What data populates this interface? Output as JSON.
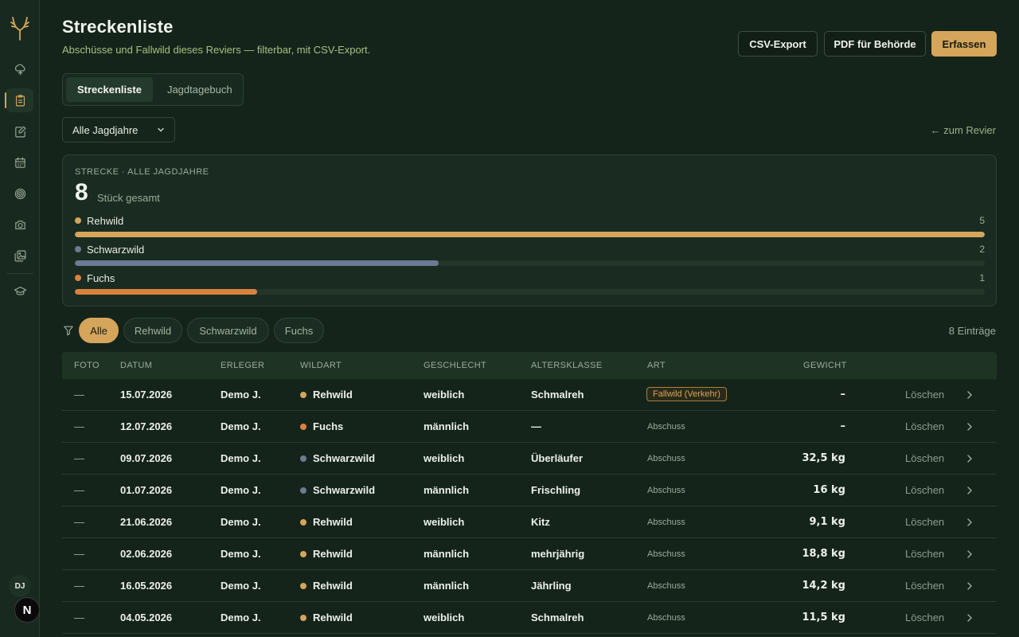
{
  "sidebar": {
    "icons": [
      "antlers-logo-icon",
      "tree-icon",
      "clipboard-icon",
      "notebook-pen-icon",
      "calendar-icon",
      "target-icon",
      "camera-icon",
      "image-gallery-icon",
      "graduation-cap-icon"
    ],
    "active_index": 2,
    "user_initials": "DJ",
    "badge": "N"
  },
  "header": {
    "title": "Streckenliste",
    "subtitle": "Abschüsse und Fallwild dieses Reviers — filterbar, mit CSV-Export.",
    "csv_label": "CSV-Export",
    "pdf_label": "PDF für Behörde",
    "add_label": "Erfassen"
  },
  "tabs": [
    {
      "label": "Streckenliste",
      "active": true
    },
    {
      "label": "Jagdtagebuch",
      "active": false
    }
  ],
  "season_select": "Alle Jagdjahre",
  "back_link": "← zum Revier",
  "summary": {
    "label": "STRECKE · ALLE JAGDJAHRE",
    "total": "8",
    "total_label": "Stück gesamt",
    "species": [
      {
        "name": "Rehwild",
        "count": 5,
        "color": "#d4a55a"
      },
      {
        "name": "Schwarzwild",
        "count": 2,
        "color": "#6c7a93"
      },
      {
        "name": "Fuchs",
        "count": 1,
        "color": "#d9823f"
      }
    ]
  },
  "filters": {
    "chips": [
      "Alle",
      "Rehwild",
      "Schwarzwild",
      "Fuchs"
    ],
    "active": "Alle",
    "count_label": "8 Einträge"
  },
  "table": {
    "headers": [
      "FOTO",
      "DATUM",
      "ERLEGER",
      "WILDART",
      "GESCHLECHT",
      "ALTERSKLASSE",
      "ART",
      "GEWICHT"
    ],
    "delete_label": "Löschen",
    "rows": [
      {
        "foto": "—",
        "datum": "15.07.2026",
        "erleger": "Demo J.",
        "wildart": "Rehwild",
        "color": "#d4a55a",
        "geschlecht": "weiblich",
        "altersklasse": "Schmalreh",
        "art": "Fallwild (Verkehr)",
        "art_highlight": true,
        "gewicht": "–"
      },
      {
        "foto": "—",
        "datum": "12.07.2026",
        "erleger": "Demo J.",
        "wildart": "Fuchs",
        "color": "#d9823f",
        "geschlecht": "männlich",
        "altersklasse": "—",
        "art": "Abschuss",
        "art_highlight": false,
        "gewicht": "–"
      },
      {
        "foto": "—",
        "datum": "09.07.2026",
        "erleger": "Demo J.",
        "wildart": "Schwarzwild",
        "color": "#6c7a93",
        "geschlecht": "weiblich",
        "altersklasse": "Überläufer",
        "art": "Abschuss",
        "art_highlight": false,
        "gewicht": "32,5 kg"
      },
      {
        "foto": "—",
        "datum": "01.07.2026",
        "erleger": "Demo J.",
        "wildart": "Schwarzwild",
        "color": "#6c7a93",
        "geschlecht": "männlich",
        "altersklasse": "Frischling",
        "art": "Abschuss",
        "art_highlight": false,
        "gewicht": "16 kg"
      },
      {
        "foto": "—",
        "datum": "21.06.2026",
        "erleger": "Demo J.",
        "wildart": "Rehwild",
        "color": "#d4a55a",
        "geschlecht": "weiblich",
        "altersklasse": "Kitz",
        "art": "Abschuss",
        "art_highlight": false,
        "gewicht": "9,1 kg"
      },
      {
        "foto": "—",
        "datum": "02.06.2026",
        "erleger": "Demo J.",
        "wildart": "Rehwild",
        "color": "#d4a55a",
        "geschlecht": "männlich",
        "altersklasse": "mehrjährig",
        "art": "Abschuss",
        "art_highlight": false,
        "gewicht": "18,8 kg"
      },
      {
        "foto": "—",
        "datum": "16.05.2026",
        "erleger": "Demo J.",
        "wildart": "Rehwild",
        "color": "#d4a55a",
        "geschlecht": "männlich",
        "altersklasse": "Jährling",
        "art": "Abschuss",
        "art_highlight": false,
        "gewicht": "14,2 kg"
      },
      {
        "foto": "—",
        "datum": "04.05.2026",
        "erleger": "Demo J.",
        "wildart": "Rehwild",
        "color": "#d4a55a",
        "geschlecht": "weiblich",
        "altersklasse": "Schmalreh",
        "art": "Abschuss",
        "art_highlight": false,
        "gewicht": "11,5 kg"
      }
    ]
  }
}
